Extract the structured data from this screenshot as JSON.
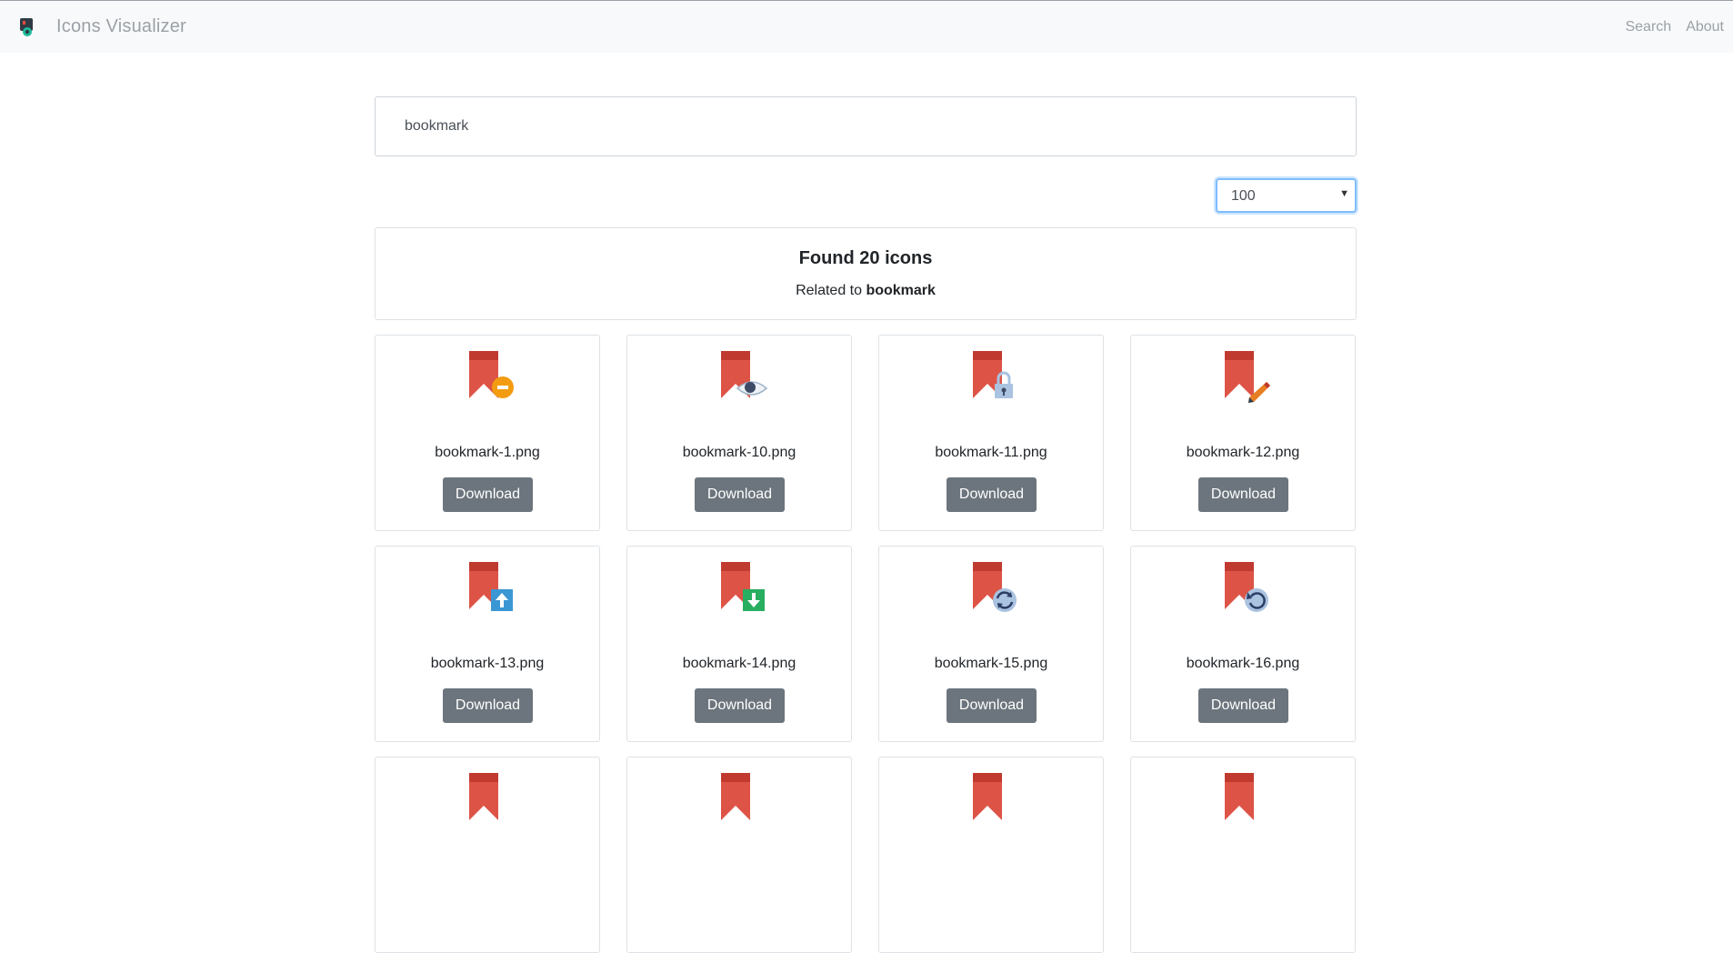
{
  "navbar": {
    "brand": "Icons Visualizer",
    "links": [
      "Search",
      "About"
    ]
  },
  "search": {
    "value": "bookmark"
  },
  "page_size": {
    "selected": "100"
  },
  "summary": {
    "title": "Found 20 icons",
    "related_prefix": "Related to",
    "query": "bookmark"
  },
  "colors": {
    "bookmark_red": "#dd5447",
    "bookmark_top": "#c13a30",
    "button_gray": "#6c757d",
    "navbar_bg": "#f8f9fa",
    "focus_blue": "#80bdff"
  },
  "icons": [
    {
      "name": "bookmark-1.png",
      "badge": "minus-circle-icon",
      "download": "Download"
    },
    {
      "name": "bookmark-10.png",
      "badge": "eye-icon",
      "download": "Download"
    },
    {
      "name": "bookmark-11.png",
      "badge": "lock-icon",
      "download": "Download"
    },
    {
      "name": "bookmark-12.png",
      "badge": "pencil-icon",
      "download": "Download"
    },
    {
      "name": "bookmark-13.png",
      "badge": "arrow-up-icon",
      "download": "Download"
    },
    {
      "name": "bookmark-14.png",
      "badge": "arrow-down-icon",
      "download": "Download"
    },
    {
      "name": "bookmark-15.png",
      "badge": "refresh-icon",
      "download": "Download"
    },
    {
      "name": "bookmark-16.png",
      "badge": "undo-icon",
      "download": "Download"
    },
    {
      "name": "",
      "badge": "",
      "download": ""
    },
    {
      "name": "",
      "badge": "",
      "download": ""
    },
    {
      "name": "",
      "badge": "",
      "download": ""
    },
    {
      "name": "",
      "badge": "",
      "download": ""
    }
  ]
}
